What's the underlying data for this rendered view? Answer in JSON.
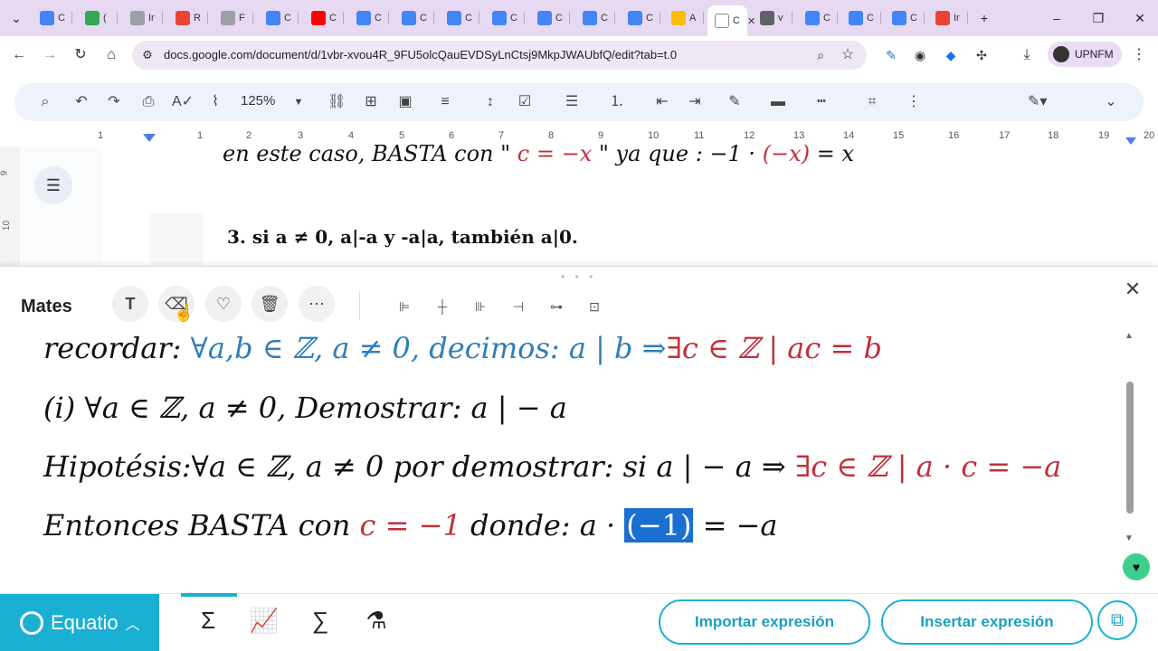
{
  "browser": {
    "tabs": [
      {
        "label": "C",
        "color": "#4285f4"
      },
      {
        "label": "(",
        "color": "#34a853"
      },
      {
        "label": "Ir",
        "color": "#9aa0a6"
      },
      {
        "label": "R",
        "color": "#ea4335"
      },
      {
        "label": "F",
        "color": "#9aa0a6"
      },
      {
        "label": "C",
        "color": "#4285f4"
      },
      {
        "label": "C",
        "color": "#ff0000"
      },
      {
        "label": "C",
        "color": "#4285f4"
      },
      {
        "label": "C",
        "color": "#4285f4"
      },
      {
        "label": "C",
        "color": "#4285f4"
      },
      {
        "label": "C",
        "color": "#4285f4"
      },
      {
        "label": "C",
        "color": "#4285f4"
      },
      {
        "label": "C",
        "color": "#4285f4"
      },
      {
        "label": "C",
        "color": "#4285f4"
      },
      {
        "label": "A",
        "color": "#fbbc04"
      },
      {
        "label": "C",
        "color": "#ffffff"
      },
      {
        "label": "v",
        "color": "#5f6368"
      },
      {
        "label": "C",
        "color": "#4285f4"
      },
      {
        "label": "C",
        "color": "#4285f4"
      },
      {
        "label": "C",
        "color": "#4285f4"
      },
      {
        "label": "Ir",
        "color": "#ea4335"
      }
    ],
    "url": "docs.google.com/document/d/1vbr-xvou4R_9FU5olcQauEVDSyLnCtsj9MkpJWAUbfQ/edit?tab=t.0",
    "profile_name": "UPNFM"
  },
  "docs_toolbar": {
    "zoom": "125%"
  },
  "ruler": {
    "numbers": [
      "1",
      "1",
      "2",
      "3",
      "4",
      "5",
      "6",
      "7",
      "8",
      "9",
      "10",
      "11",
      "12",
      "13",
      "14",
      "15",
      "16",
      "17",
      "18",
      "19",
      "20"
    ],
    "vertical": [
      "9",
      "10"
    ]
  },
  "document": {
    "line1_text": "en este caso, BASTA con \"",
    "line1_red1": "c = −x",
    "line1_text2": "\" ya que : −1 ·",
    "line1_red2": "(−x)",
    "line1_text3": "= x",
    "line2": "3.  si a ≠ 0,  a|-a  y  -a|a,  también a|0."
  },
  "equatio": {
    "panel_title": "Mates",
    "math_lines": {
      "l1_a": "recordar",
      "l1_b": ": ",
      "l1_c": "∀a,b ∈ ℤ, a ≠ 0, decimos: a | b ⇒",
      "l1_d": "∃c ∈ ℤ | ac = b",
      "l2": "(i) ∀a ∈ ℤ, a ≠ 0, Demostrar: a | − a",
      "l3_a": "Hipotésis:∀a ∈ ℤ, a ≠ 0 por demostrar: si a | − a  ⇒ ",
      "l3_b": "∃c ∈ ℤ | a · c = −a",
      "l4_a": "Entonces BASTA con ",
      "l4_b": "c = −1",
      "l4_c": " donde:  a · ",
      "l4_d": "(−1)",
      "l4_e": " = −a"
    },
    "brand": "Equatio",
    "import_label": "Importar expresión",
    "insert_label": "Insertar expresión"
  },
  "colors": {
    "accent": "#1ab0d4",
    "math_blue": "#2f7fb6",
    "math_red": "#c0303a",
    "highlight": "#1a6fd1"
  }
}
